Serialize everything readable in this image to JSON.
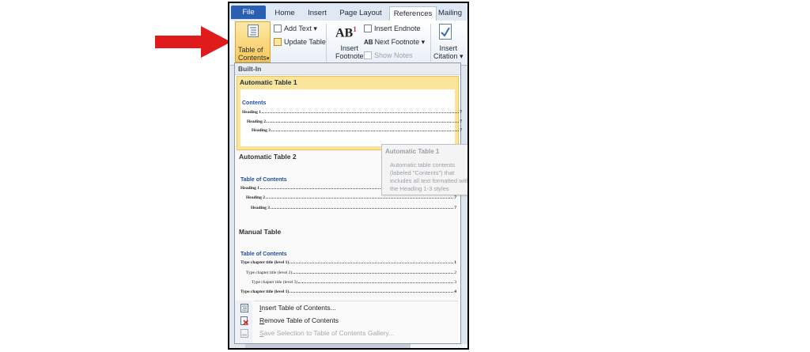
{
  "annotation": {
    "arrow_color": "#e01b1b"
  },
  "ribbon": {
    "tabs": [
      {
        "label": "File"
      },
      {
        "label": "Home"
      },
      {
        "label": "Insert"
      },
      {
        "label": "Page Layout"
      },
      {
        "label": "References"
      },
      {
        "label": "Mailing"
      }
    ],
    "toc_button": {
      "line1": "Table of",
      "line2": "Contents",
      "arrow": "▾"
    },
    "add_text": "Add Text ▾",
    "update_table": "Update Table",
    "insert_footnote_icon": "AB",
    "insert_footnote_sup": "1",
    "insert_footnote": {
      "line1": "Insert",
      "line2": "Footnote"
    },
    "insert_endnote": "Insert Endnote",
    "next_footnote": "Next Footnote ▾",
    "show_notes": "Show Notes",
    "insert_citation": {
      "line1": "Insert",
      "line2": "Citation ▾"
    },
    "colors": {
      "file_tab": "#2a5fb4",
      "active_button": "#f8c85a"
    }
  },
  "menu": {
    "section_label": "Built-In",
    "galleries": [
      {
        "title": "Automatic Table 1",
        "selected": true,
        "heading": "Contents",
        "lines": [
          {
            "text": "Heading 1",
            "page": "7"
          },
          {
            "text": "Heading 2",
            "page": "7"
          },
          {
            "text": "Heading 3",
            "page": "7"
          }
        ]
      },
      {
        "title": "Automatic Table 2",
        "heading": "Table of Contents",
        "lines": [
          {
            "text": "Heading 1",
            "page": "7"
          },
          {
            "text": "Heading 2",
            "page": "7"
          },
          {
            "text": "Heading 3",
            "page": "7"
          }
        ]
      },
      {
        "title": "Manual Table",
        "heading": "Table of Contents",
        "lines": [
          {
            "text": "Type chapter title (level 1)",
            "page": "1"
          },
          {
            "text": "Type chapter title (level 2)",
            "page": "2"
          },
          {
            "text": "Type chapter title (level 3)",
            "page": "3"
          },
          {
            "text": "Type chapter title (level 1)",
            "page": "4"
          }
        ]
      }
    ],
    "tooltip": {
      "title": "Automatic Table 1",
      "body": "Automatic table contents (labeled \"Contents\") that includes all text formatted with the Heading 1-3 styles"
    },
    "commands": [
      {
        "label": "Insert Table of Contents...",
        "enabled": true,
        "icon": "toc-doc-icon"
      },
      {
        "label": "Remove Table of Contents",
        "enabled": true,
        "icon": "remove-toc-icon"
      },
      {
        "label": "Save Selection to Table of Contents Gallery...",
        "enabled": false,
        "icon": "save-selection-icon"
      }
    ]
  }
}
